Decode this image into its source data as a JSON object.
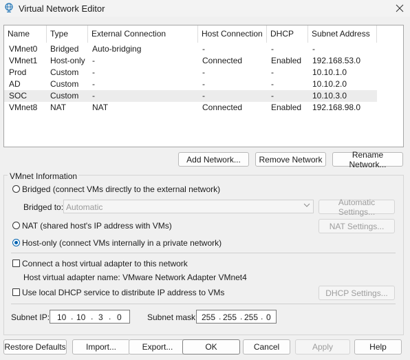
{
  "window": {
    "title": "Virtual Network Editor"
  },
  "table": {
    "columns": [
      "Name",
      "Type",
      "External Connection",
      "Host Connection",
      "DHCP",
      "Subnet Address"
    ],
    "rows": [
      {
        "name": "VMnet0",
        "type": "Bridged",
        "external": "Auto-bridging",
        "host": "-",
        "dhcp": "-",
        "subnet": "-"
      },
      {
        "name": "VMnet1",
        "type": "Host-only",
        "external": "-",
        "host": "Connected",
        "dhcp": "Enabled",
        "subnet": "192.168.53.0"
      },
      {
        "name": "Prod",
        "type": "Custom",
        "external": "-",
        "host": "-",
        "dhcp": "-",
        "subnet": "10.10.1.0"
      },
      {
        "name": "AD",
        "type": "Custom",
        "external": "-",
        "host": "-",
        "dhcp": "-",
        "subnet": "10.10.2.0"
      },
      {
        "name": "SOC",
        "type": "Custom",
        "external": "-",
        "host": "-",
        "dhcp": "-",
        "subnet": "10.10.3.0"
      },
      {
        "name": "VMnet8",
        "type": "NAT",
        "external": "NAT",
        "host": "Connected",
        "dhcp": "Enabled",
        "subnet": "192.168.98.0"
      }
    ]
  },
  "table_buttons": {
    "add": "Add Network...",
    "remove": "Remove Network",
    "rename": "Rename Network..."
  },
  "info": {
    "group_title": "VMnet Information",
    "bridged_label": "Bridged (connect VMs directly to the external network)",
    "bridged_to_label": "Bridged to:",
    "bridged_to_value": "Automatic",
    "auto_settings": "Automatic Settings...",
    "nat_label": "NAT (shared host's IP address with VMs)",
    "nat_settings": "NAT Settings...",
    "hostonly_label": "Host-only (connect VMs internally in a private network)",
    "connect_adapter_label": "Connect a host virtual adapter to this network",
    "adapter_name_label": "Host virtual adapter name: VMware Network Adapter VMnet4",
    "dhcp_label": "Use local DHCP service to distribute IP address to VMs",
    "dhcp_settings": "DHCP Settings...",
    "subnet_ip_label": "Subnet IP:",
    "subnet_ip": [
      "10",
      "10",
      "3",
      "0"
    ],
    "subnet_mask_label": "Subnet mask:",
    "subnet_mask": [
      "255",
      "255",
      "255",
      "0"
    ],
    "selected_mode": "host-only"
  },
  "footer": {
    "restore": "Restore Defaults",
    "import": "Import...",
    "export": "Export...",
    "ok": "OK",
    "cancel": "Cancel",
    "apply": "Apply",
    "help": "Help"
  },
  "colors": {
    "accent": "#0063b1",
    "selected_row": "#ececec"
  }
}
